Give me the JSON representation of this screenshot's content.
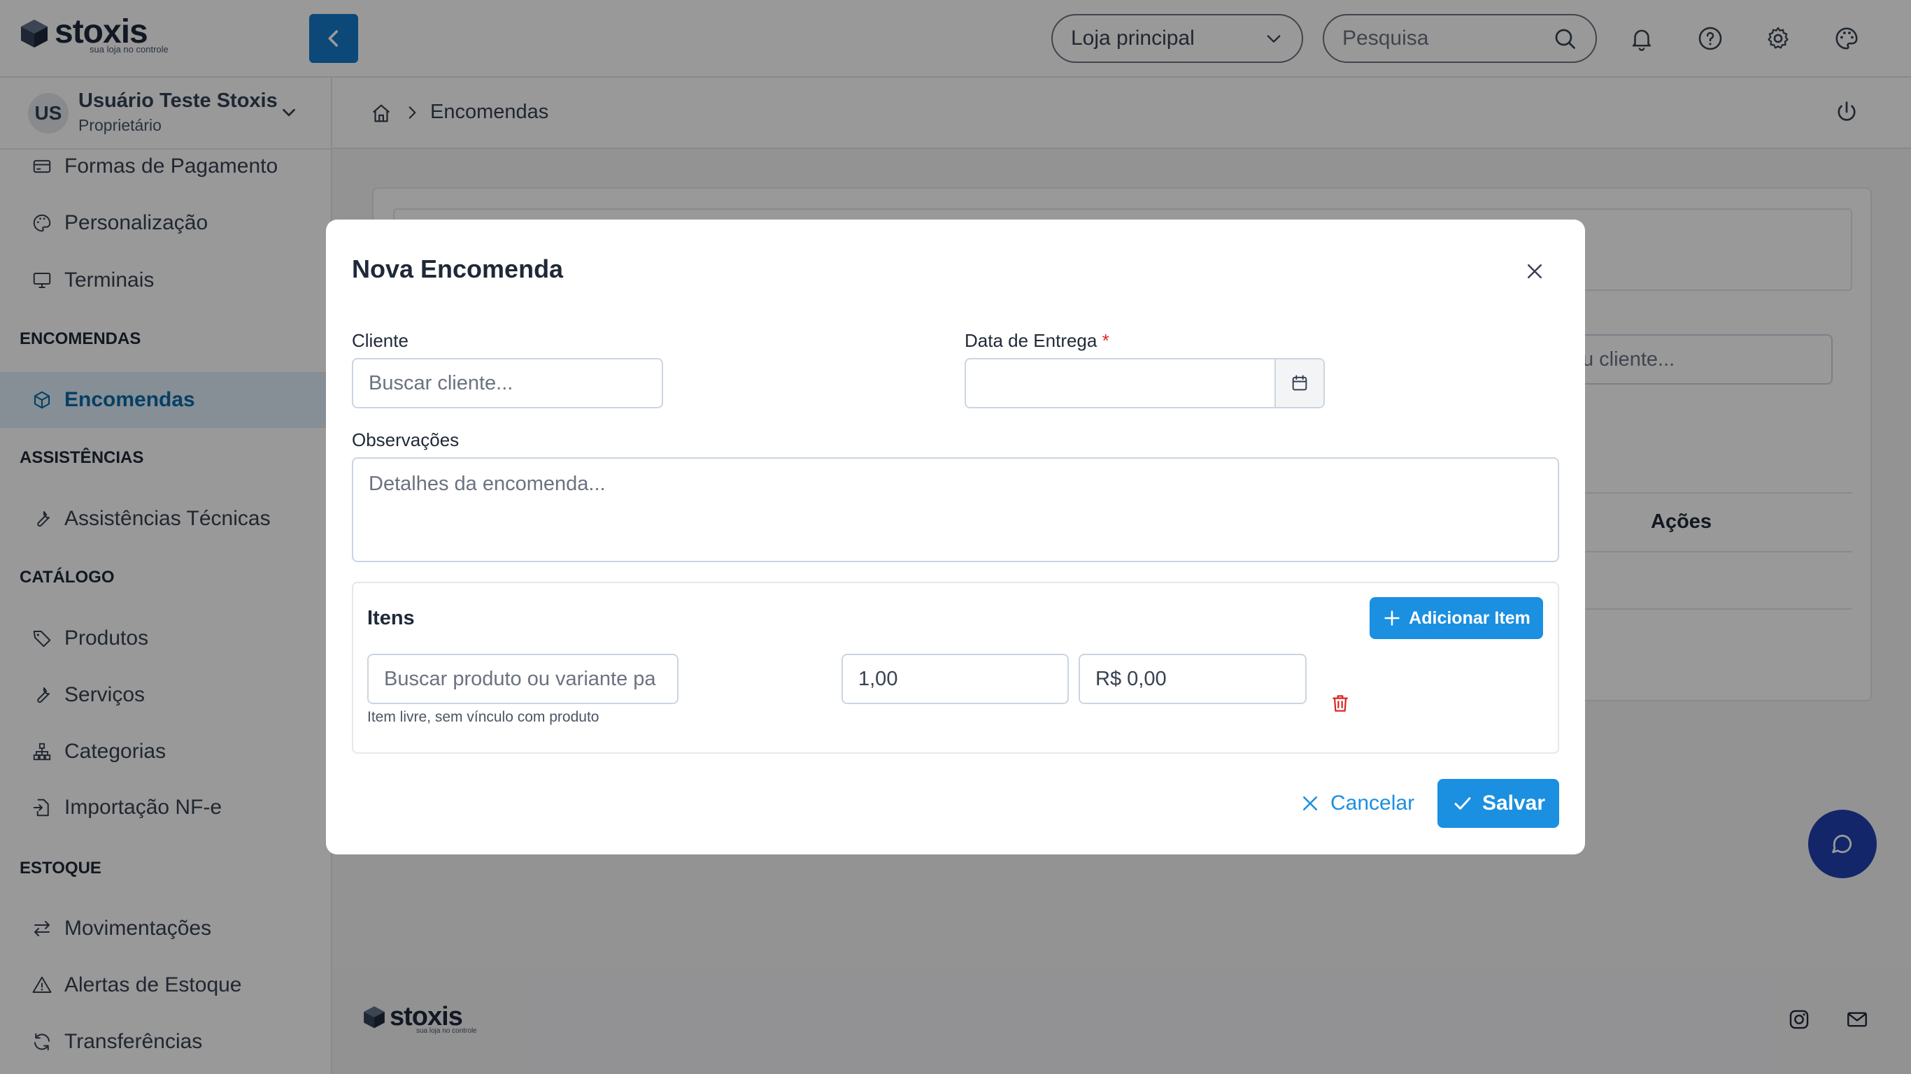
{
  "header": {
    "logo_text": "stoxis",
    "logo_tagline": "sua loja no controle",
    "store_select": "Loja principal",
    "search_placeholder": "Pesquisa"
  },
  "user": {
    "initials": "US",
    "name": "Usuário Teste Stoxis",
    "role": "Proprietário"
  },
  "sidebar": {
    "items_top": [
      {
        "label": "Formas de Pagamento",
        "icon": "credit-card-icon"
      },
      {
        "label": "Personalização",
        "icon": "palette-icon"
      },
      {
        "label": "Terminais",
        "icon": "monitor-icon"
      }
    ],
    "sections": {
      "encomendas": "ENCOMENDAS",
      "assistencias": "ASSISTÊNCIAS",
      "catalogo": "CATÁLOGO",
      "estoque": "ESTOQUE"
    },
    "encomendas_item": "Encomendas",
    "assistencias_item": "Assistências Técnicas",
    "catalogo_items": [
      "Produtos",
      "Serviços",
      "Categorias",
      "Importação NF-e"
    ],
    "estoque_items": [
      "Movimentações",
      "Alertas de Estoque",
      "Transferências"
    ]
  },
  "breadcrumb": {
    "current": "Encomendas"
  },
  "background": {
    "client_search_partial": "u cliente...",
    "actions_header": "Ações"
  },
  "modal": {
    "title": "Nova Encomenda",
    "client_label": "Cliente",
    "client_placeholder": "Buscar cliente...",
    "delivery_label": "Data de Entrega",
    "required_mark": "*",
    "notes_label": "Observações",
    "notes_placeholder": "Detalhes da encomenda...",
    "items_title": "Itens",
    "add_item_label": "Adicionar Item",
    "product_placeholder": "Buscar produto ou variante pa",
    "quantity_value": "1,00",
    "price_value": "R$ 0,00",
    "item_hint": "Item livre, sem vínculo com produto",
    "cancel_label": "Cancelar",
    "save_label": "Salvar"
  },
  "colors": {
    "primary": "#1b8fe0",
    "collapse_button": "#1479c9",
    "active_bg": "#dfeefb",
    "active_text": "#0b6aa8",
    "chat_fab": "#1e40af",
    "danger": "#dc2626"
  }
}
